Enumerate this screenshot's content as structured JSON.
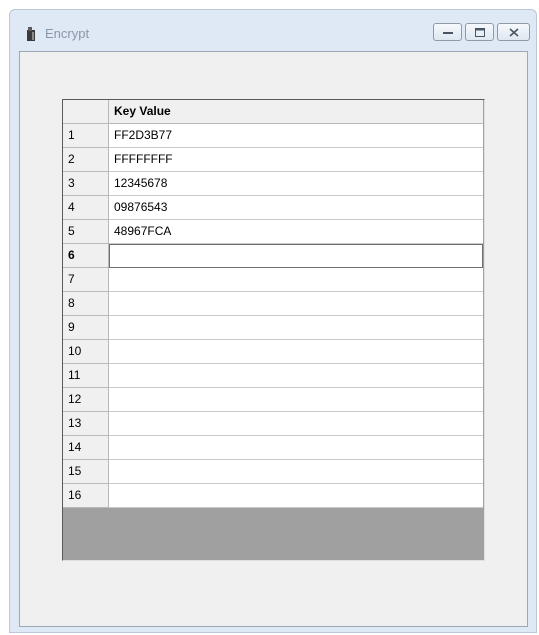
{
  "window": {
    "title": "Encrypt"
  },
  "grid": {
    "header": "Key Value",
    "rows": [
      {
        "num": "1",
        "value": "FF2D3B77"
      },
      {
        "num": "2",
        "value": "FFFFFFFF"
      },
      {
        "num": "3",
        "value": "12345678"
      },
      {
        "num": "4",
        "value": "09876543"
      },
      {
        "num": "5",
        "value": "48967FCA"
      },
      {
        "num": "6",
        "value": ""
      },
      {
        "num": "7",
        "value": ""
      },
      {
        "num": "8",
        "value": ""
      },
      {
        "num": "9",
        "value": ""
      },
      {
        "num": "10",
        "value": ""
      },
      {
        "num": "11",
        "value": ""
      },
      {
        "num": "12",
        "value": ""
      },
      {
        "num": "13",
        "value": ""
      },
      {
        "num": "14",
        "value": ""
      },
      {
        "num": "15",
        "value": ""
      },
      {
        "num": "16",
        "value": ""
      }
    ]
  }
}
